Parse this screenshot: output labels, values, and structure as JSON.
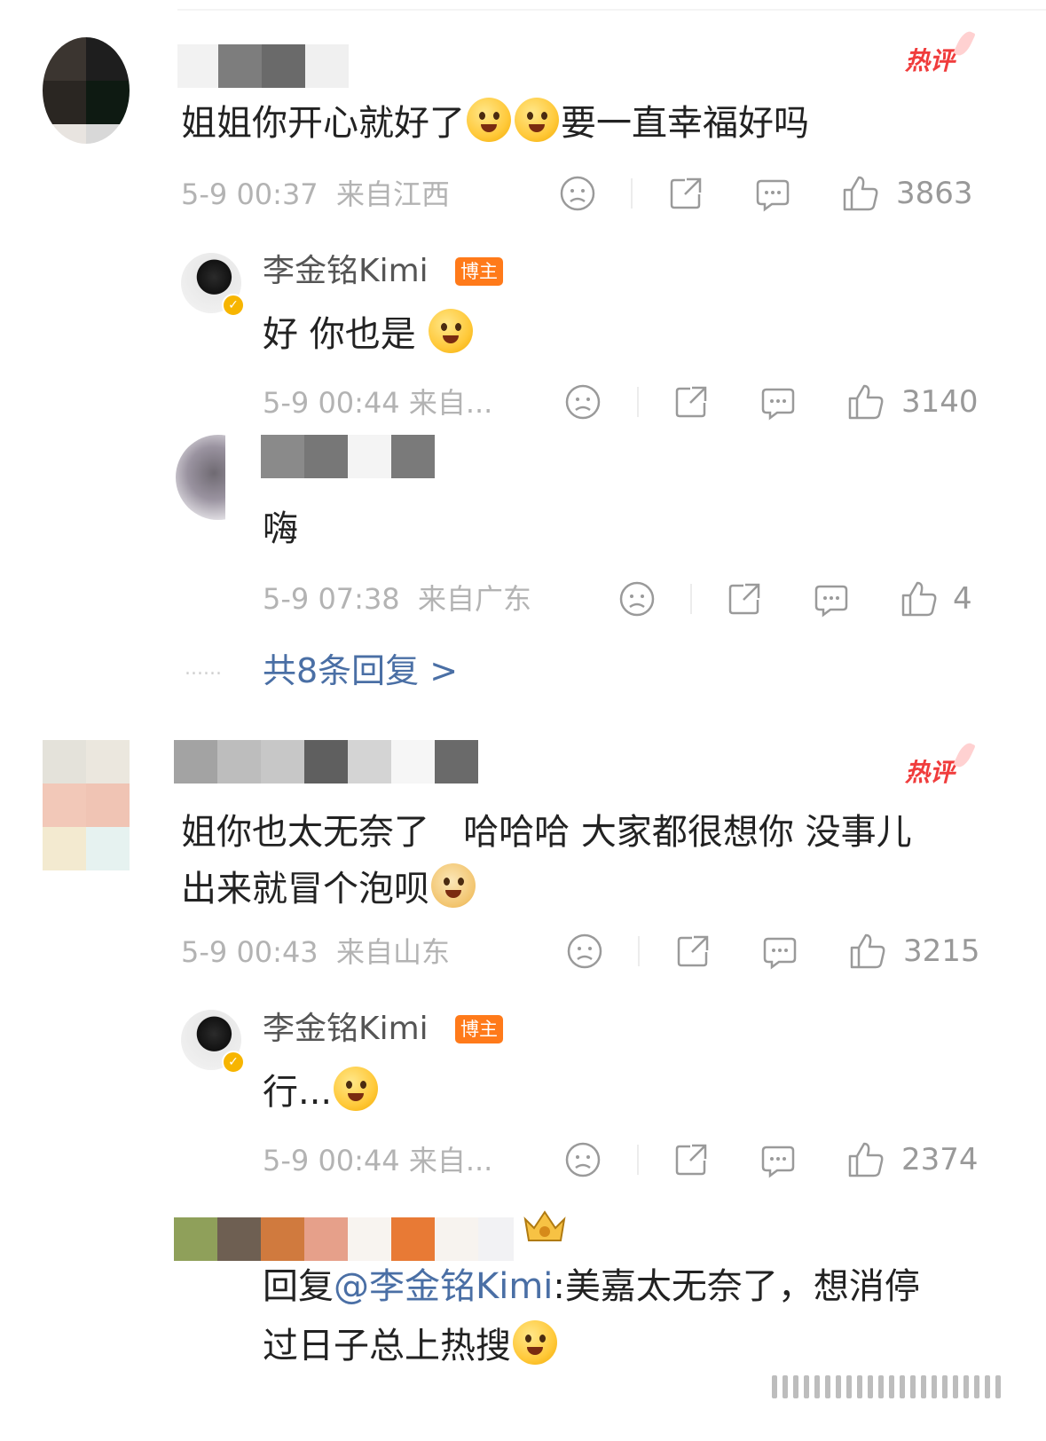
{
  "hot_label": "热评",
  "comments": [
    {
      "text": "姐姐你开心就好了",
      "text_after": "要一直幸福好吗",
      "time": "5-9 00:37",
      "location": "来自江西",
      "likes": "3863",
      "replies": [
        {
          "name": "李金铭Kimi",
          "badge": "博主",
          "text": "好 你也是",
          "time": "5-9 00:44",
          "location": "来自...",
          "likes": "3140"
        },
        {
          "text": "嗨",
          "time": "5-9 07:38",
          "location": "来自广东",
          "likes": "4"
        }
      ],
      "more_replies": "共8条回复 >",
      "dots": "......"
    },
    {
      "text_line1": "姐你也太无奈了   哈哈哈 大家都很想你 没事儿",
      "text_line2": "出来就冒个泡呗",
      "time": "5-9 00:43",
      "location": "来自山东",
      "likes": "3215",
      "replies": [
        {
          "name": "李金铭Kimi",
          "badge": "博主",
          "text": "行...",
          "time": "5-9 00:44",
          "location": "来自...",
          "likes": "2374"
        },
        {
          "prefix": "回复",
          "mention": "@李金铭Kimi",
          "text_line1": ":美嘉太无奈了，想消停",
          "text_line2": "过日子总上热搜"
        }
      ]
    }
  ],
  "colors": {
    "hot": "#f03c3c",
    "badge": "#ff7a1a",
    "mention": "#4a6fa5",
    "meta": "#b3b3b3"
  },
  "icons": [
    "dislike-icon",
    "share-icon",
    "comment-icon",
    "like-icon",
    "vip-crown-icon"
  ]
}
